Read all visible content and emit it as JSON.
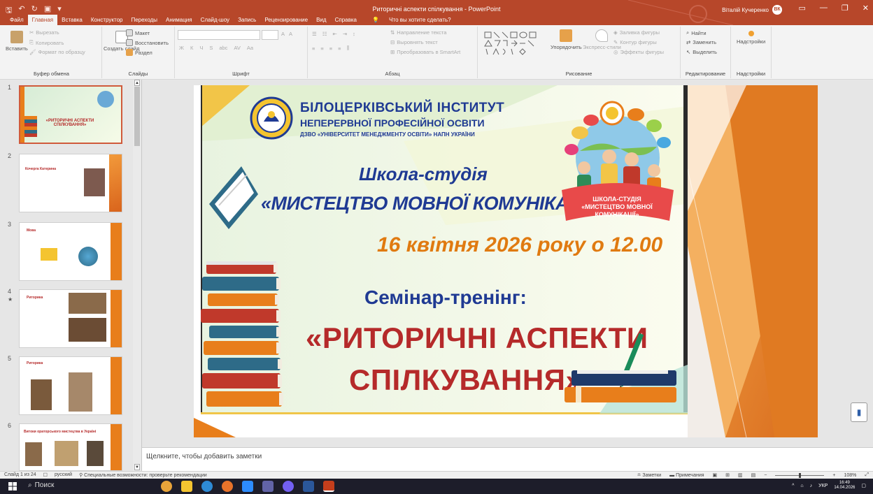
{
  "titlebar": {
    "title": "Риторичні аспекти спілкування - PowerPoint",
    "user": "Віталій Кучеренко",
    "user_initials": "ВК",
    "search_placeholder": "Что вы хотите сделать?",
    "tabs": [
      "Файл",
      "Главная",
      "Вставка",
      "Конструктор",
      "Переходы",
      "Анимация",
      "Слайд-шоу",
      "Запись",
      "Рецензирование",
      "Вид",
      "Справка"
    ]
  },
  "ribbon": {
    "clipboard": {
      "paste": "Вставить",
      "cut": "Вырезать",
      "copy": "Копировать",
      "format": "Формат по образцу",
      "label": "Буфер обмена"
    },
    "slides": {
      "new": "Создать слайд",
      "layout": "Макет",
      "reset": "Восстановить",
      "section": "Раздел",
      "label": "Слайды"
    },
    "font": {
      "size_up": "A",
      "size_down": "A",
      "bold": "Ж",
      "italic": "К",
      "underline": "Ч",
      "shadow": "S",
      "strike": "abc",
      "spacing": "AV",
      "case": "Aa",
      "label": "Шрифт"
    },
    "paragraph": {
      "direction": "Направление текста",
      "align": "Выровнять текст",
      "smartart": "Преобразовать в SmartArt",
      "label": "Абзац"
    },
    "drawing": {
      "arrange": "Упорядочить",
      "styles": "Экспресс-стили",
      "fill": "Заливка фигуры",
      "outline": "Контур фигуры",
      "effects": "Эффекты фигуры",
      "label": "Рисование"
    },
    "editing": {
      "find": "Найти",
      "replace": "Заменить",
      "select": "Выделить",
      "label": "Редактирование"
    },
    "addins": {
      "btn": "Надстройки",
      "label": "Надстройки"
    }
  },
  "thumbnails": [
    {
      "num": "1",
      "title": "«РИТОРИЧНІ АСПЕКТИ СПІЛКУВАННЯ»"
    },
    {
      "num": "2",
      "title": "Кочерга Катерина"
    },
    {
      "num": "3",
      "title": "Мова"
    },
    {
      "num": "4",
      "title": "Риторика"
    },
    {
      "num": "5",
      "title": "Риторика"
    },
    {
      "num": "6",
      "title": "Витоки ораторського мистецтва в Україні"
    }
  ],
  "thumb_star": "★",
  "slide": {
    "inst1": "БІЛОЦЕРКІВСЬКИЙ ІНСТИТУТ",
    "inst2": "НЕПЕРЕРВНОЇ ПРОФЕСІЙНОЇ ОСВІТИ",
    "inst3": "ДЗВО «УНІВЕРСИТЕТ МЕНЕДЖМЕНТУ ОСВІТИ» НАПН УКРАЇНИ",
    "school": "Школа-студія",
    "school_name": "«МИСТЕЦТВО МОВНОЇ КОМУНІКАЦІЇ»",
    "date": "16 квітня 2026 року о 12.00",
    "seminar": "Семінар-тренінг:",
    "topic1": "«РИТОРИЧНІ АСПЕКТИ",
    "topic2": "СПІЛКУВАННЯ»",
    "badge1": "ШКОЛА-СТУДІЯ",
    "badge2": "«МИСТЕЦТВО МОВНОЇ",
    "badge3": "КОМУНІКАЦІЇ»"
  },
  "notes_placeholder": "Щелкните, чтобы добавить заметки",
  "status": {
    "slide": "Слайд 1 из 24",
    "lang": "русский",
    "access": "Специальные возможности: проверьте рекомендации",
    "notes": "Заметки",
    "comments": "Примечания",
    "zoom": "108%"
  },
  "taskbar": {
    "search": "Поиск",
    "lang": "УКР",
    "time": "16:49",
    "date": "14.04.2026"
  },
  "colors": {
    "accent": "#b7472a",
    "orange": "#e87e1b",
    "blue": "#1f3a93",
    "red": "#b52a2a"
  }
}
